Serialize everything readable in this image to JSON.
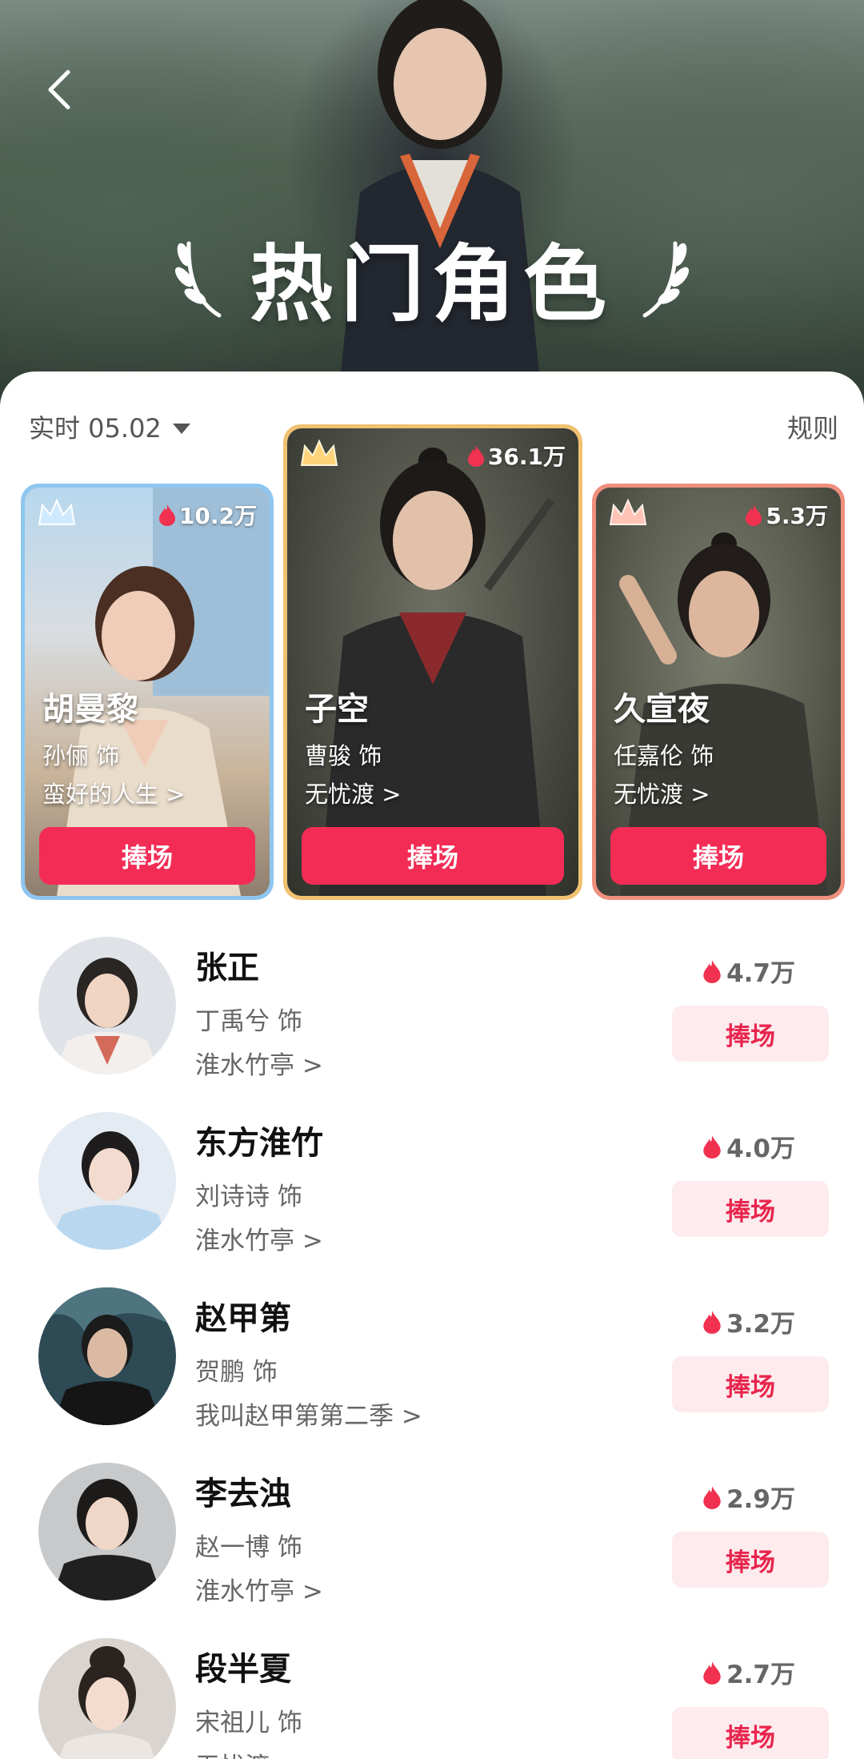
{
  "header": {
    "title": "热门角色"
  },
  "filter": {
    "label": "实时 05.02"
  },
  "rules_label": "规则",
  "top3": [
    {
      "rank": 2,
      "heat": "10.2万",
      "name": "胡曼黎",
      "actor": "孙俪 饰",
      "show": "蛮好的人生 >",
      "cheer": "捧场",
      "frame_color": "#8ec6ef"
    },
    {
      "rank": 1,
      "heat": "36.1万",
      "name": "子空",
      "actor": "曹骏 饰",
      "show": "无忧渡 >",
      "cheer": "捧场",
      "frame_color": "#f0c170"
    },
    {
      "rank": 3,
      "heat": "5.3万",
      "name": "久宣夜",
      "actor": "任嘉伦 饰",
      "show": "无忧渡 >",
      "cheer": "捧场",
      "frame_color": "#ef8f7e"
    }
  ],
  "list": [
    {
      "name": "张正",
      "actor": "丁禹兮 饰",
      "show": "淮水竹亭 >",
      "heat": "4.7万",
      "cheer": "捧场"
    },
    {
      "name": "东方淮竹",
      "actor": "刘诗诗 饰",
      "show": "淮水竹亭 >",
      "heat": "4.0万",
      "cheer": "捧场"
    },
    {
      "name": "赵甲第",
      "actor": "贺鹏 饰",
      "show": "我叫赵甲第第二季 >",
      "heat": "3.2万",
      "cheer": "捧场"
    },
    {
      "name": "李去浊",
      "actor": "赵一博 饰",
      "show": "淮水竹亭 >",
      "heat": "2.9万",
      "cheer": "捧场"
    },
    {
      "name": "段半夏",
      "actor": "宋祖儿 饰",
      "show": "无忧渡 >",
      "heat": "2.7万",
      "cheer": "捧场"
    }
  ],
  "colors": {
    "accent": "#f32c56",
    "cheer_light_bg": "#fdebee",
    "flame": "#f0314f"
  }
}
